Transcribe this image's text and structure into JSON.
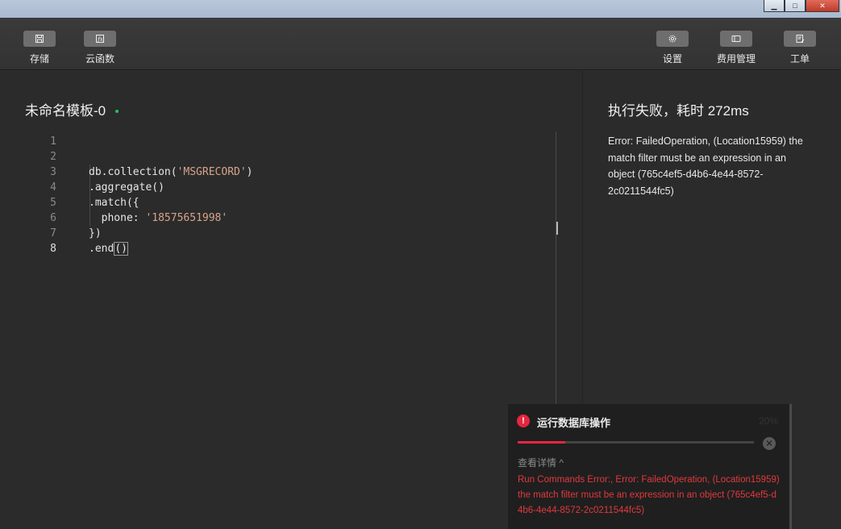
{
  "toolbar": {
    "left": [
      {
        "label": "存储",
        "icon": "save-icon"
      },
      {
        "label": "云函数",
        "icon": "function-icon"
      }
    ],
    "right": [
      {
        "label": "设置",
        "icon": "gear-icon"
      },
      {
        "label": "费用管理",
        "icon": "billing-icon"
      },
      {
        "label": "工单",
        "icon": "ticket-icon"
      }
    ]
  },
  "editor": {
    "title": "未命名模板-0",
    "active_line": 8,
    "lines": [
      {
        "num": "1",
        "text": ""
      },
      {
        "num": "2",
        "text": ""
      },
      {
        "num": "3",
        "pre": "db.collection(",
        "str": "'MSGRECORD'",
        "post": ")"
      },
      {
        "num": "4",
        "pre": ".aggregate()"
      },
      {
        "num": "5",
        "pre": ".match({"
      },
      {
        "num": "6",
        "pre": "  phone: ",
        "str": "'18575651998'",
        "post": ""
      },
      {
        "num": "7",
        "pre": "})"
      },
      {
        "num": "8",
        "pre": ".end",
        "paren": "()"
      }
    ]
  },
  "result": {
    "title": "执行失败，耗时 272ms",
    "message": "Error: FailedOperation, (Location15959) the match filter must be an expression in an object (765c4ef5-d4b6-4e44-8572-2c0211544fc5)"
  },
  "notification": {
    "title": "运行数据库操作",
    "percent": "20%",
    "progress": 0.2,
    "details_label": "查看详情 ^",
    "error": "Run Commands Error:, Error: FailedOperation, (Location15959) the match filter must be an expression in an object (765c4ef5-d4b6-4e44-8572-2c0211544fc5)"
  },
  "colors": {
    "accent_error": "#e5263f",
    "success_dot": "#22c55e"
  }
}
